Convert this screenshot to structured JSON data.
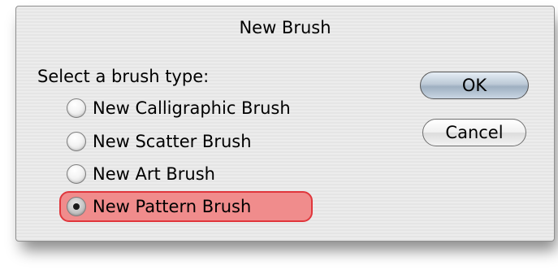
{
  "dialog": {
    "title": "New Brush",
    "prompt": "Select a brush type:",
    "options": [
      {
        "label": "New Calligraphic Brush",
        "selected": false
      },
      {
        "label": "New Scatter Brush",
        "selected": false
      },
      {
        "label": "New Art Brush",
        "selected": false
      },
      {
        "label": "New Pattern Brush",
        "selected": true
      }
    ],
    "buttons": {
      "ok": "OK",
      "cancel": "Cancel"
    },
    "highlight_color": "#f08c8c",
    "highlight_border_color": "#e0363c"
  }
}
